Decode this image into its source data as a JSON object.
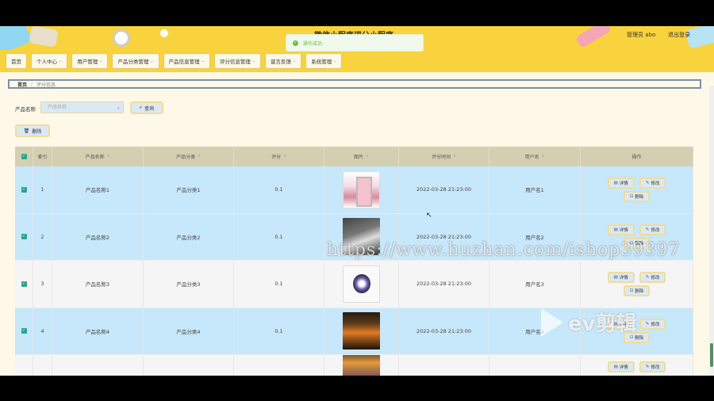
{
  "header": {
    "site_title": "微信小程序评分小程序",
    "admin_label": "管理员 abo",
    "logout_label": "退出登录"
  },
  "toast": {
    "message": "操作成功"
  },
  "nav": {
    "items": [
      {
        "label": "首页",
        "has_menu": false
      },
      {
        "label": "个人中心",
        "has_menu": true
      },
      {
        "label": "用户管理",
        "has_menu": true
      },
      {
        "label": "产品分类管理",
        "has_menu": true
      },
      {
        "label": "产品信息管理",
        "has_menu": true
      },
      {
        "label": "评分信息管理",
        "has_menu": true
      },
      {
        "label": "留言反馈",
        "has_menu": true
      },
      {
        "label": "系统管理",
        "has_menu": true
      }
    ]
  },
  "breadcrumb": {
    "home": "首页",
    "current": "评分信息"
  },
  "search": {
    "label": "产品名称",
    "placeholder": "产品名称",
    "button": "查询"
  },
  "actions": {
    "delete_label": "删除"
  },
  "table": {
    "headers": [
      "索引",
      "产品名称",
      "产品分类",
      "评分",
      "图片",
      "评分时间",
      "用户名",
      "操作"
    ],
    "op_labels": {
      "detail": "详情",
      "edit": "修改",
      "delete": "删除"
    },
    "rows": [
      {
        "index": "1",
        "name": "产品名称1",
        "category": "产品分类1",
        "score": "0.1",
        "time": "2022-03-28 21:23:00",
        "user": "用户名1"
      },
      {
        "index": "2",
        "name": "产品名称2",
        "category": "产品分类2",
        "score": "0.1",
        "time": "2022-03-28 21:23:00",
        "user": "用户名2"
      },
      {
        "index": "3",
        "name": "产品名称3",
        "category": "产品分类3",
        "score": "0.1",
        "time": "2022-03-28 21:23:00",
        "user": "用户名3"
      },
      {
        "index": "4",
        "name": "产品名称4",
        "category": "产品分类4",
        "score": "0.1",
        "time": "2022-03-28 21:23:00",
        "user": "用户名4"
      }
    ]
  },
  "overlay": {
    "watermark": "https://www.huzhan.com/ishop39397",
    "logo_text": "ev剪辑"
  }
}
